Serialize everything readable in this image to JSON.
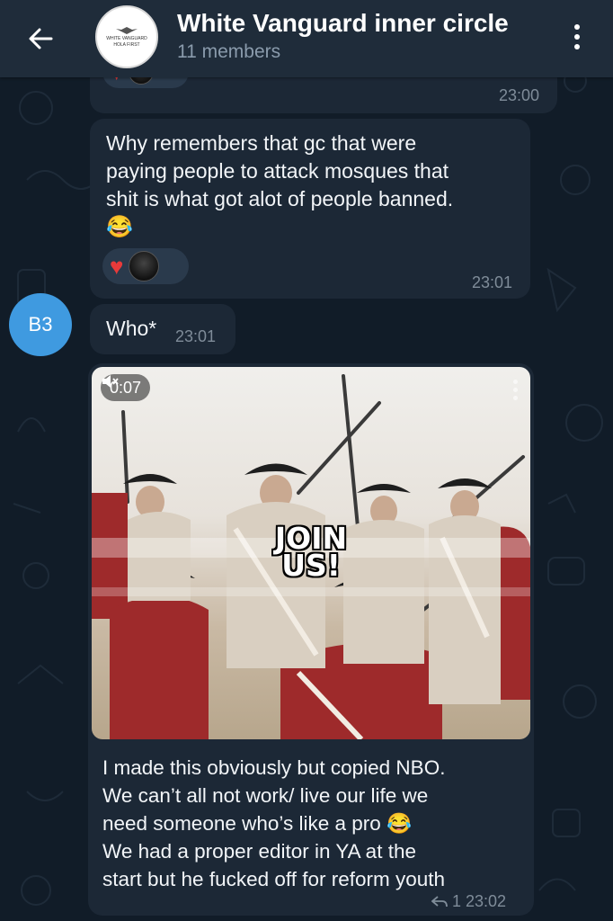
{
  "header": {
    "title": "White Vanguard inner circle",
    "subtitle": "11 members",
    "avatar_lines": [
      "WHITE VANGUARD",
      "HOLA FIRST"
    ]
  },
  "messages": [
    {
      "id": "m0",
      "time": "23:00",
      "reactions": [
        "heart",
        "avatar"
      ]
    },
    {
      "id": "m1",
      "lines": [
        "Why remembers that gc that were",
        "paying people to attack mosques that",
        "shit is what got alot of people banned."
      ],
      "emoji": "😂",
      "time": "23:01",
      "reactions": [
        "heart",
        "avatar"
      ]
    },
    {
      "id": "m2",
      "sender_initials": "B3",
      "text": "Who*",
      "time": "23:01"
    },
    {
      "id": "m3",
      "video": {
        "duration": "0:07",
        "mute_icon": "muted-speaker-icon",
        "overlay_lines": [
          "JOIN",
          "US!"
        ]
      },
      "lines": [
        "I made this obviously but copied NBO.",
        "We can’t all not work/ live our life we",
        "need someone who’s like a pro 😂",
        "We had a proper editor in YA at the",
        "start but he fucked off for reform youth"
      ],
      "replies": "1",
      "time": "23:02"
    }
  ],
  "colors": {
    "background": "#0e1621",
    "header": "#1f2c3a",
    "bubble": "#1c2836",
    "accent_avatar": "#3f9ae0",
    "heart": "#e83a3a"
  }
}
